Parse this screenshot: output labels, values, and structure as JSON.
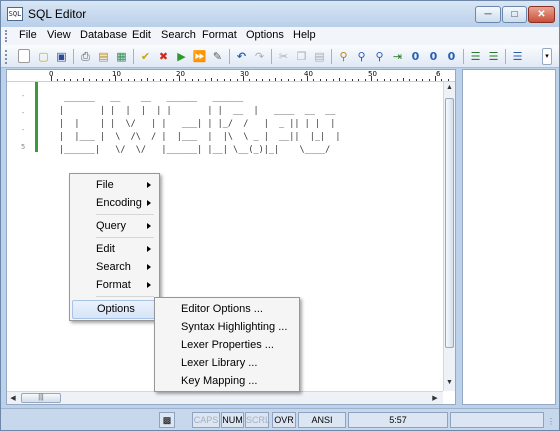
{
  "window": {
    "title": "SQL Editor",
    "app_icon": "SQL"
  },
  "menubar": {
    "items": [
      "File",
      "View",
      "Database",
      "Edit",
      "Search",
      "Format",
      "Options",
      "Help"
    ]
  },
  "toolbar": {
    "icons": [
      "new-file-icon",
      "open-folder-icon",
      "save-icon",
      "print-icon",
      "database-icon",
      "database-connect-icon",
      "check-icon",
      "cancel-icon",
      "run-icon",
      "run-all-icon",
      "clear-icon",
      "undo-icon",
      "redo-icon",
      "cut-icon",
      "copy-icon",
      "paste-icon",
      "find-icon",
      "find-next-icon",
      "replace-icon",
      "indent-icon",
      "bookmark-icon",
      "bookmark-next-icon",
      "bookmark-clear-icon",
      "move-left-icon",
      "move-right-icon",
      "list-icon"
    ]
  },
  "ruler": {
    "labels": [
      "0",
      "10",
      "20",
      "30",
      "40",
      "50",
      "6"
    ]
  },
  "editor": {
    "line_numbers": [
      "-",
      "-",
      "-",
      "5"
    ],
    "lines": [
      " ______   __    __   ______   ______                  ",
      "|       | |  |  |  | |       | |  __  |   ____  __  __ ",
      "|  |    | |  \\/   | |   ___| | |_/  /   |  _ || | |  |",
      "|  |___ |  \\  /\\  / |  |___  |  |\\  \\ _ |  __||  |_|  |",
      "|______|   \\/  \\/   |______| |__| \\__(_)|_|    \\____/ "
    ]
  },
  "context_menu": {
    "items": [
      "File",
      "Encoding",
      "Query",
      "Edit",
      "Search",
      "Format",
      "Options"
    ],
    "submenu": [
      "Editor Options ...",
      "Syntax Highlighting ...",
      "Lexer Properties ...",
      "Lexer Library ...",
      "Key Mapping ..."
    ]
  },
  "statusbar": {
    "caps": "CAPS",
    "num": "NUM",
    "scrl": "SCRL",
    "ovr": "OVR",
    "encoding": "ANSI",
    "position": "5:57"
  },
  "colors": {
    "accent": "#3c9a3c",
    "frame": "#bcd1ea"
  }
}
